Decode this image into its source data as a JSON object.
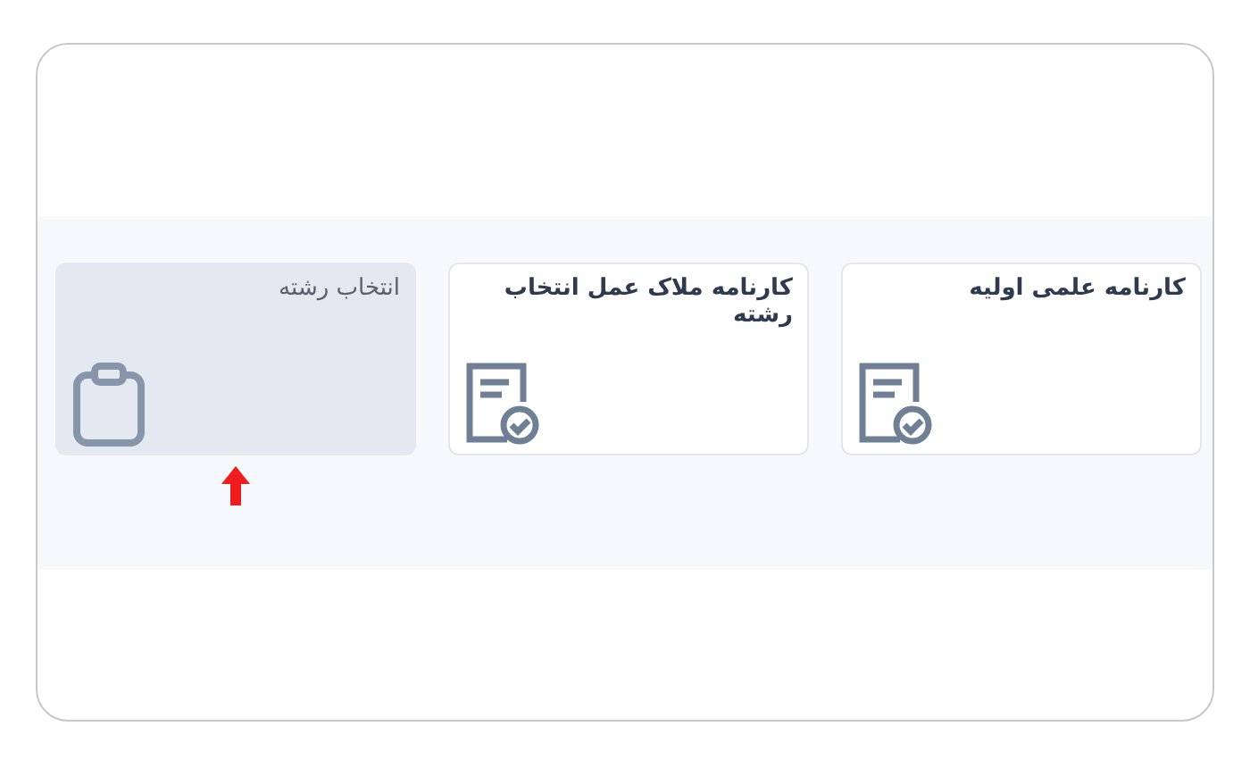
{
  "cards": [
    {
      "title": "کارنامه علمی اولیه",
      "kind": "report",
      "selected": false
    },
    {
      "title": "کارنامه ملاک عمل انتخاب رشته",
      "kind": "report",
      "selected": false
    },
    {
      "title": "انتخاب رشته",
      "kind": "clipboard",
      "selected": true
    }
  ]
}
